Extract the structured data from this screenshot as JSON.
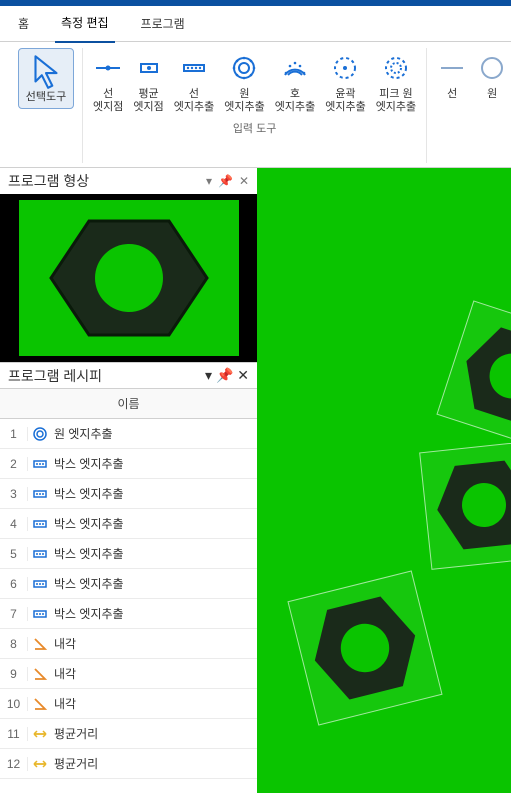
{
  "menu": {
    "home": "홈",
    "measure_edit": "측정 편집",
    "program": "프로그램"
  },
  "ribbon": {
    "select_tool": "선택도구",
    "line_edge_point": "선\n엣지점",
    "avg_edge_point": "평균\n엣지점",
    "line_edge_extract": "선\n엣지추출",
    "circle_edge_extract": "원\n엣지추출",
    "arc_edge_extract": "호\n엣지추출",
    "contour_edge_extract": "윤곽\n엣지추출",
    "peak_circle_edge_extract": "피크 원\n엣지추출",
    "line": "선",
    "circle": "원",
    "group_input": "입력 도구"
  },
  "panels": {
    "program_shape": "프로그램 형상",
    "program_recipe": "프로그램 레시피",
    "col_name": "이름"
  },
  "recipe": {
    "items": [
      {
        "n": "1",
        "type": "circle",
        "label": "원 엣지추출"
      },
      {
        "n": "2",
        "type": "box",
        "label": "박스 엣지추출"
      },
      {
        "n": "3",
        "type": "box",
        "label": "박스 엣지추출"
      },
      {
        "n": "4",
        "type": "box",
        "label": "박스 엣지추출"
      },
      {
        "n": "5",
        "type": "box",
        "label": "박스 엣지추출"
      },
      {
        "n": "6",
        "type": "box",
        "label": "박스 엣지추출"
      },
      {
        "n": "7",
        "type": "box",
        "label": "박스 엣지추출"
      },
      {
        "n": "8",
        "type": "angle",
        "label": "내각"
      },
      {
        "n": "9",
        "type": "angle",
        "label": "내각"
      },
      {
        "n": "10",
        "type": "angle",
        "label": "내각"
      },
      {
        "n": "11",
        "type": "dist",
        "label": "평균거리"
      },
      {
        "n": "12",
        "type": "dist",
        "label": "평균거리"
      }
    ]
  }
}
